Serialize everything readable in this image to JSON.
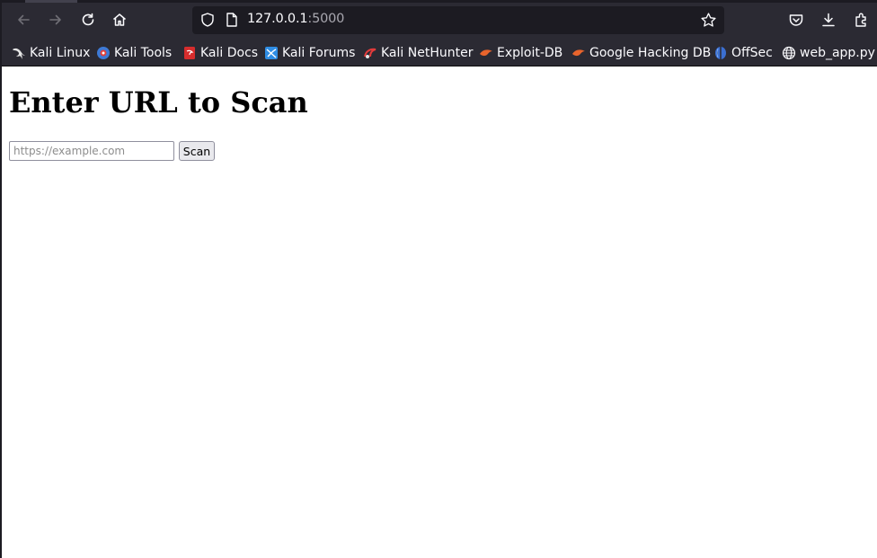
{
  "browser": {
    "url_host": "127.0.0.1",
    "url_port": ":5000",
    "nav_icons": [
      "back-arrow-icon",
      "forward-arrow-icon",
      "reload-icon",
      "home-icon"
    ],
    "right_icons": [
      "pocket-icon",
      "download-icon",
      "extensions-icon"
    ]
  },
  "bookmarks": [
    {
      "label": "Kali Linux",
      "icon": "kali-dragon-icon"
    },
    {
      "label": "Kali Tools",
      "icon": "kali-tools-icon"
    },
    {
      "label": "Kali Docs",
      "icon": "kali-docs-icon"
    },
    {
      "label": "Kali Forums",
      "icon": "kali-forums-icon"
    },
    {
      "label": "Kali NetHunter",
      "icon": "kali-nethunter-icon"
    },
    {
      "label": "Exploit-DB",
      "icon": "exploit-db-icon"
    },
    {
      "label": "Google Hacking DB",
      "icon": "ghdb-icon"
    },
    {
      "label": "OffSec",
      "icon": "offsec-icon"
    },
    {
      "label": "web_app.py",
      "icon": "globe-icon"
    }
  ],
  "page": {
    "title": "Enter URL to Scan",
    "input_placeholder": "https://example.com",
    "input_value": "",
    "scan_label": "Scan"
  },
  "colors": {
    "toolbar_bg": "#2b2a33",
    "urlbar_bg": "#1c1b22",
    "text_light": "#fbfbfe"
  }
}
